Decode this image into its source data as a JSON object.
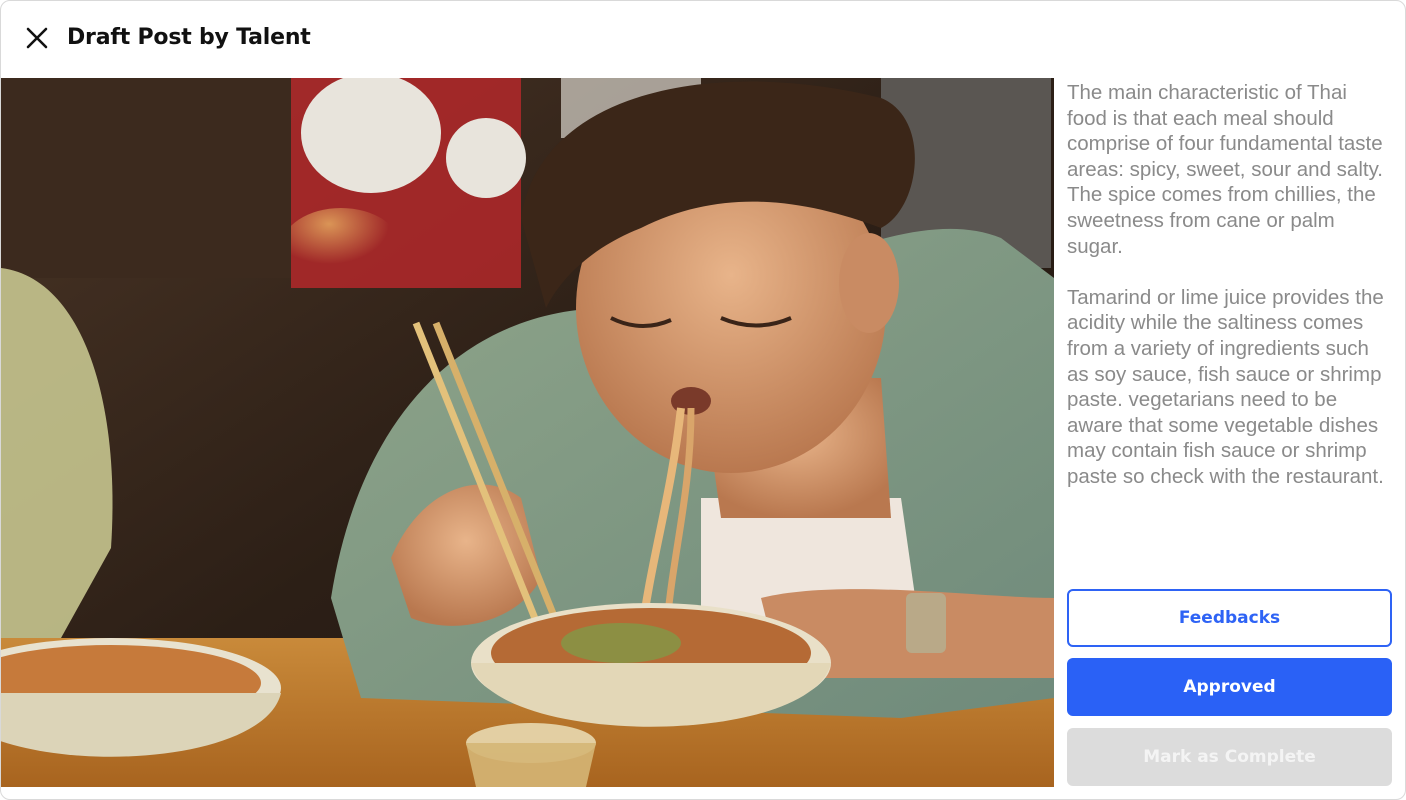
{
  "header": {
    "title": "Draft Post by Talent",
    "close_icon": "close-icon"
  },
  "post": {
    "image_subject": "photo-person-eating-noodles",
    "description": "The main characteristic of Thai food is that each meal should comprise of four fundamental taste areas: spicy, sweet, sour and salty. The spice comes from chillies, the sweetness from cane or palm sugar.\n\nTamarind or lime juice provides the acidity while the saltiness comes from a variety of ingredients such as soy sauce, fish sauce or shrimp paste. vegetarians need to be aware that some vegetable dishes may contain fish sauce or shrimp paste so check with the restaurant."
  },
  "actions": {
    "feedbacks_label": "Feedbacks",
    "approved_label": "Approved",
    "complete_label": "Mark as Complete"
  },
  "colors": {
    "primary": "#2a61f6",
    "disabled": "#dcdcdc",
    "body_text": "#8a8a8a"
  }
}
